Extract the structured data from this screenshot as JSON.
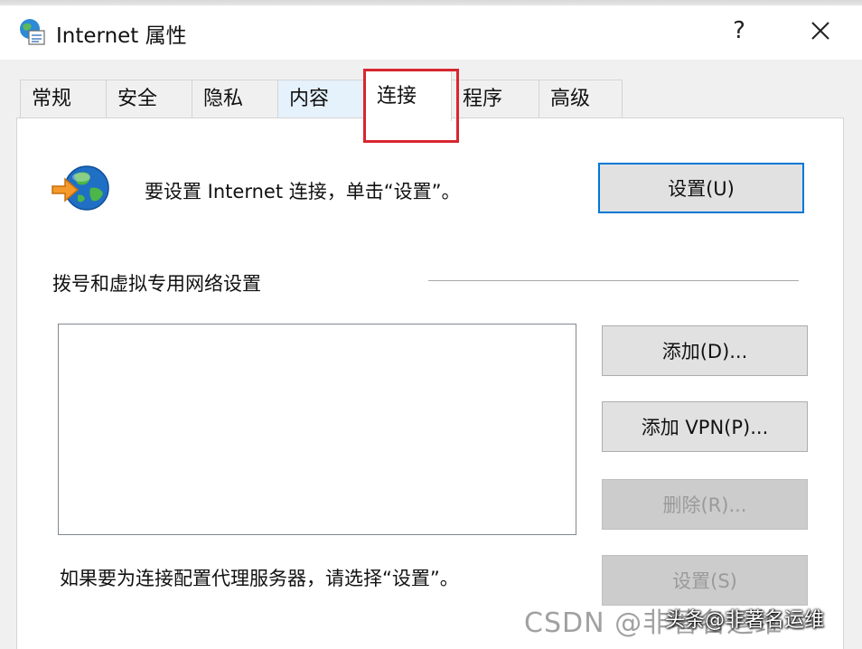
{
  "window": {
    "title": "Internet 属性",
    "help_glyph": "?",
    "close_glyph": "✕"
  },
  "tabs": [
    {
      "label": "常规",
      "active": false
    },
    {
      "label": "安全",
      "active": false
    },
    {
      "label": "隐私",
      "active": false
    },
    {
      "label": "内容",
      "active": false
    },
    {
      "label": "连接",
      "active": true
    },
    {
      "label": "程序",
      "active": false
    },
    {
      "label": "高级",
      "active": false
    }
  ],
  "connection": {
    "setup_text": "要设置 Internet 连接，单击“设置”。",
    "setup_button": "设置(U)"
  },
  "dialup": {
    "section_label": "拨号和虚拟专用网络设置",
    "add_button": "添加(D)...",
    "add_vpn_button": "添加 VPN(P)...",
    "remove_button": "删除(R)...",
    "settings_button": "设置(S)"
  },
  "proxy": {
    "text": "如果要为连接配置代理服务器，请选择“设置”。"
  },
  "watermark": {
    "csdn": "CSDN @非著名运维",
    "toutiao": "头条@非著名运维"
  },
  "colors": {
    "highlight": "#d7262f",
    "focus": "#0078d7"
  }
}
